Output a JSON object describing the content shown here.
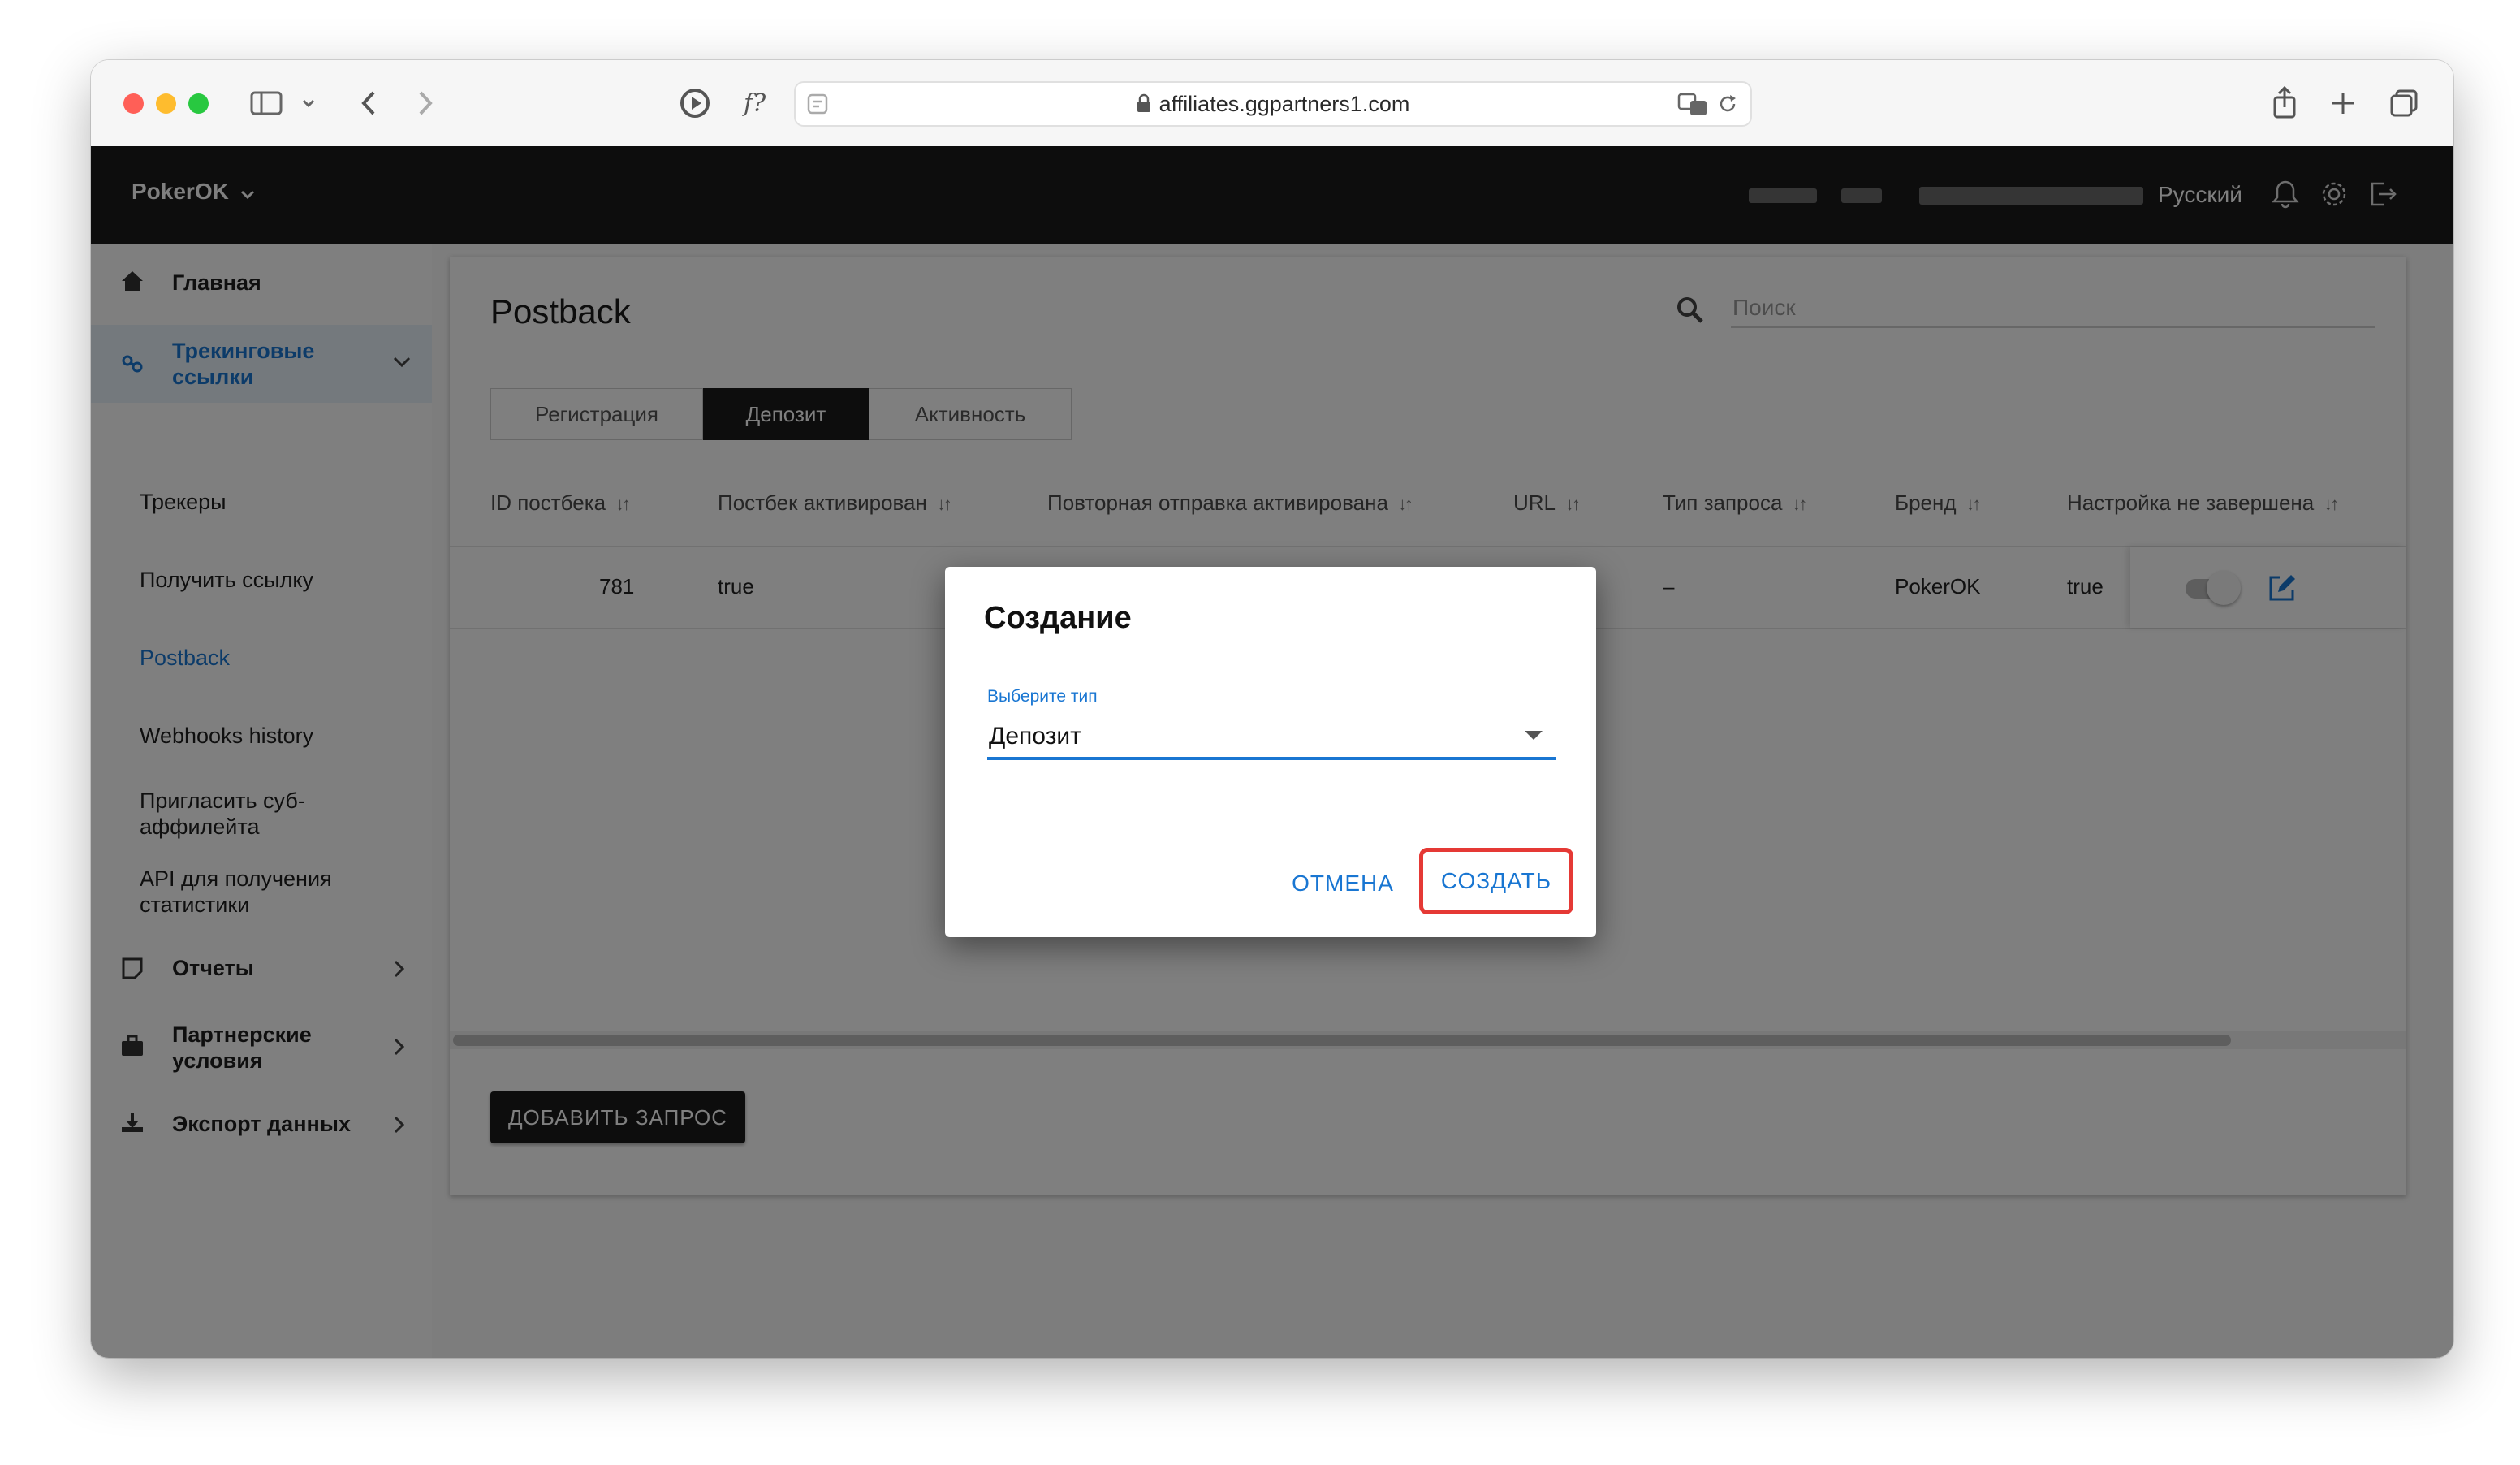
{
  "browser": {
    "url": "affiliates.ggpartners1.com"
  },
  "header": {
    "brand": "PokerOK",
    "language": "Русский"
  },
  "sidebar": {
    "items": [
      {
        "label": "Главная",
        "icon": "home-icon"
      },
      {
        "label": "Трекинговые ссылки",
        "icon": "link-icon",
        "active": true
      },
      {
        "label": "Отчеты",
        "icon": "report-icon"
      },
      {
        "label": "Партнерские условия",
        "icon": "briefcase-icon"
      },
      {
        "label": "Экспорт данных",
        "icon": "download-icon"
      }
    ],
    "subitems": [
      {
        "label": "Трекеры"
      },
      {
        "label": "Получить ссылку"
      },
      {
        "label": "Postback",
        "active": true
      },
      {
        "label": "Webhooks history"
      },
      {
        "label": "Пригласить суб-аффилейта"
      },
      {
        "label": "API для получения статистики"
      }
    ]
  },
  "main": {
    "title": "Postback",
    "search_placeholder": "Поиск",
    "tabs": [
      {
        "label": "Регистрация"
      },
      {
        "label": "Депозит",
        "selected": true
      },
      {
        "label": "Активность"
      }
    ],
    "columns": [
      "ID постбека",
      "Постбек активирован",
      "Повторная отправка активирована",
      "URL",
      "Тип запроса",
      "Бренд",
      "Настройка не завершена"
    ],
    "rows": [
      {
        "id": "781",
        "active": "true",
        "request_type": "–",
        "brand": "PokerOK",
        "incomplete": "true"
      }
    ],
    "add_button": "ДОБАВИТЬ ЗАПРОС"
  },
  "dialog": {
    "title": "Создание",
    "select_label": "Выберите тип",
    "select_value": "Депозит",
    "cancel": "ОТМЕНА",
    "create": "СОЗДАТЬ"
  },
  "colors": {
    "accent": "#1976d2",
    "highlight": "#e53935",
    "header": "#1b1b1b"
  }
}
